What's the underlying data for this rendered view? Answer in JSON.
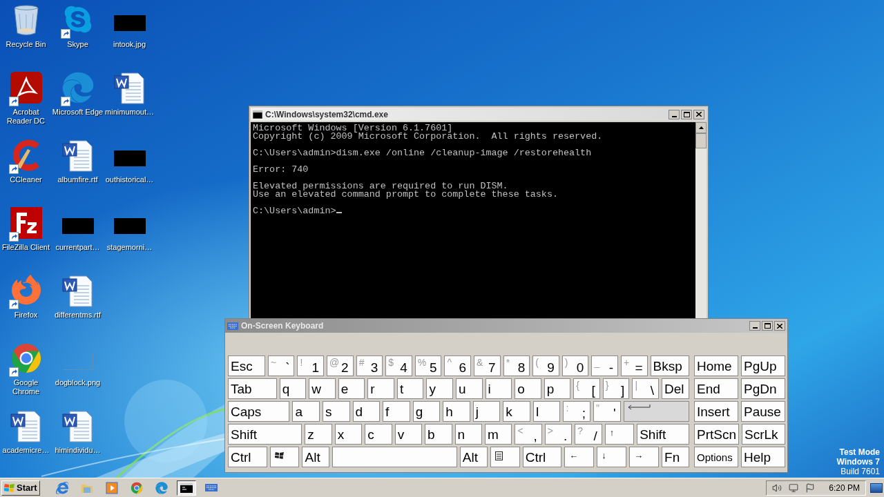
{
  "desktop": {
    "icons": [
      {
        "label": "Recycle Bin",
        "kind": "bin",
        "shortcut": false
      },
      {
        "label": "Acrobat Reader DC",
        "kind": "acrobat",
        "shortcut": true
      },
      {
        "label": "CCleaner",
        "kind": "ccleaner",
        "shortcut": true
      },
      {
        "label": "FileZilla Client",
        "kind": "filezilla",
        "shortcut": true
      },
      {
        "label": "Firefox",
        "kind": "firefox",
        "shortcut": true
      },
      {
        "label": "Google Chrome",
        "kind": "chrome",
        "shortcut": true
      },
      {
        "label": "academicre…",
        "kind": "word",
        "shortcut": false
      },
      {
        "label": "Skype",
        "kind": "skype",
        "shortcut": true
      },
      {
        "label": "Microsoft Edge",
        "kind": "edge",
        "shortcut": true
      },
      {
        "label": "albumfire.rtf",
        "kind": "word",
        "shortcut": false
      },
      {
        "label": "currentpart…",
        "kind": "black-image",
        "shortcut": false
      },
      {
        "label": "differentms.rtf",
        "kind": "word",
        "shortcut": false
      },
      {
        "label": "dogblock.png",
        "kind": "blank-image",
        "shortcut": false
      },
      {
        "label": "himindividu…",
        "kind": "word",
        "shortcut": false
      },
      {
        "label": "intook.jpg",
        "kind": "black-image",
        "shortcut": false
      },
      {
        "label": "minimumout…",
        "kind": "word",
        "shortcut": false
      },
      {
        "label": "outhistorical…",
        "kind": "black-image",
        "shortcut": false
      },
      {
        "label": "stagemorni…",
        "kind": "black-image",
        "shortcut": false
      }
    ],
    "watermark": [
      "Test Mode",
      "Windows 7",
      "Build 7601"
    ]
  },
  "console": {
    "title": "C:\\Windows\\system32\\cmd.exe",
    "cursor": true,
    "blocks": [
      [
        "Microsoft Windows [Version 6.1.7601]",
        "Copyright (c) 2009 Microsoft Corporation.  All rights reserved."
      ],
      [
        "C:\\Users\\admin>dism.exe /online /cleanup-image /restorehealth"
      ],
      [
        "Error: 740"
      ],
      [
        "Elevated permissions are required to run DISM.",
        "Use an elevated command prompt to complete these tasks."
      ],
      [
        "C:\\Users\\admin>"
      ]
    ]
  },
  "keyboard": {
    "title": "On-Screen Keyboard",
    "rows": [
      {
        "keys": [
          {
            "kind": "text",
            "label": "Esc"
          },
          {
            "kind": "dual",
            "shift": "~",
            "label": "`"
          },
          {
            "kind": "dual",
            "shift": "!",
            "label": "1"
          },
          {
            "kind": "dual",
            "shift": "@",
            "label": "2"
          },
          {
            "kind": "dual",
            "shift": "#",
            "label": "3"
          },
          {
            "kind": "dual",
            "shift": "$",
            "label": "4"
          },
          {
            "kind": "dual",
            "shift": "%",
            "label": "5"
          },
          {
            "kind": "dual",
            "shift": "^",
            "label": "6"
          },
          {
            "kind": "dual",
            "shift": "&",
            "label": "7"
          },
          {
            "kind": "dual",
            "shift": "*",
            "label": "8"
          },
          {
            "kind": "dual",
            "shift": "(",
            "label": "9"
          },
          {
            "kind": "dual",
            "shift": ")",
            "label": "0"
          },
          {
            "kind": "dual",
            "shift": "_",
            "label": "-"
          },
          {
            "kind": "dual",
            "shift": "+",
            "label": "="
          },
          {
            "kind": "text",
            "label": "Bksp"
          }
        ]
      },
      {
        "keys": [
          {
            "kind": "text",
            "label": "Tab"
          },
          {
            "kind": "text",
            "label": "q"
          },
          {
            "kind": "text",
            "label": "w"
          },
          {
            "kind": "text",
            "label": "e"
          },
          {
            "kind": "text",
            "label": "r"
          },
          {
            "kind": "text",
            "label": "t"
          },
          {
            "kind": "text",
            "label": "y"
          },
          {
            "kind": "text",
            "label": "u"
          },
          {
            "kind": "text",
            "label": "i"
          },
          {
            "kind": "text",
            "label": "o"
          },
          {
            "kind": "text",
            "label": "p"
          },
          {
            "kind": "dual",
            "shift": "{",
            "label": "["
          },
          {
            "kind": "dual",
            "shift": "}",
            "label": "]"
          },
          {
            "kind": "dual",
            "shift": "|",
            "label": "\\"
          },
          {
            "kind": "text",
            "label": "Del"
          }
        ]
      },
      {
        "keys": [
          {
            "kind": "text",
            "label": "Caps"
          },
          {
            "kind": "text",
            "label": "a"
          },
          {
            "kind": "text",
            "label": "s"
          },
          {
            "kind": "text",
            "label": "d"
          },
          {
            "kind": "text",
            "label": "f"
          },
          {
            "kind": "text",
            "label": "g"
          },
          {
            "kind": "text",
            "label": "h"
          },
          {
            "kind": "text",
            "label": "j"
          },
          {
            "kind": "text",
            "label": "k"
          },
          {
            "kind": "text",
            "label": "l"
          },
          {
            "kind": "dual",
            "shift": ":",
            "label": ";"
          },
          {
            "kind": "dual",
            "shift": "\"",
            "label": "'"
          },
          {
            "kind": "enter"
          }
        ]
      },
      {
        "keys": [
          {
            "kind": "text",
            "label": "Shift"
          },
          {
            "kind": "text",
            "label": "z"
          },
          {
            "kind": "text",
            "label": "x"
          },
          {
            "kind": "text",
            "label": "c"
          },
          {
            "kind": "text",
            "label": "v"
          },
          {
            "kind": "text",
            "label": "b"
          },
          {
            "kind": "text",
            "label": "n"
          },
          {
            "kind": "text",
            "label": "m"
          },
          {
            "kind": "dual",
            "shift": "<",
            "label": ","
          },
          {
            "kind": "dual",
            "shift": ">",
            "label": "."
          },
          {
            "kind": "dual",
            "shift": "?",
            "label": "/"
          },
          {
            "kind": "arrow",
            "label": "↑"
          },
          {
            "kind": "text",
            "label": "Shift"
          }
        ]
      },
      {
        "keys": [
          {
            "kind": "text",
            "label": "Ctrl"
          },
          {
            "kind": "windows"
          },
          {
            "kind": "text",
            "label": "Alt"
          },
          {
            "kind": "space"
          },
          {
            "kind": "text",
            "label": "Alt"
          },
          {
            "kind": "menu"
          },
          {
            "kind": "text",
            "label": "Ctrl"
          },
          {
            "kind": "arrow",
            "label": "←"
          },
          {
            "kind": "arrow",
            "label": "↓"
          },
          {
            "kind": "arrow",
            "label": "→"
          },
          {
            "kind": "text",
            "label": "Fn"
          }
        ]
      }
    ],
    "nav": [
      [
        "Home",
        "PgUp"
      ],
      [
        "End",
        "PgDn"
      ],
      [
        "Insert",
        "Pause"
      ],
      [
        "PrtScn",
        "ScrLk"
      ],
      [
        "Options",
        "Help"
      ]
    ]
  },
  "taskbar": {
    "start": "Start",
    "apps": [
      {
        "kind": "ie",
        "selected": false
      },
      {
        "kind": "explorer",
        "selected": false
      },
      {
        "kind": "media",
        "selected": false
      },
      {
        "kind": "chrome",
        "selected": false
      },
      {
        "kind": "edge",
        "selected": false
      },
      {
        "kind": "cmd",
        "selected": true
      },
      {
        "kind": "osk",
        "selected": false
      }
    ],
    "clock": "6:20 PM"
  }
}
